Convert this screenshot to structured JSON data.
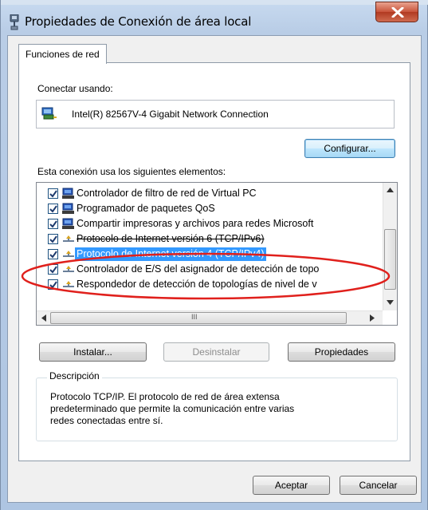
{
  "window": {
    "title": "Propiedades de Conexión de área local",
    "close_icon": "close-icon"
  },
  "tabs": [
    {
      "label": "Funciones de red",
      "active": true
    }
  ],
  "connect_using": {
    "label": "Conectar usando:",
    "adapter_name": "Intel(R) 82567V-4 Gigabit Network Connection",
    "adapter_icon": "network-adapter-icon",
    "configure_button": "Configurar..."
  },
  "components": {
    "label": "Esta conexión usa los siguientes elementos:",
    "items": [
      {
        "label": "Controlador de filtro de red de Virtual PC",
        "checked": true,
        "icon": "network-client-icon",
        "selected": false
      },
      {
        "label": "Programador de paquetes QoS",
        "checked": true,
        "icon": "network-client-icon",
        "selected": false
      },
      {
        "label": "Compartir impresoras y archivos para redes Microsoft",
        "checked": true,
        "icon": "network-client-icon",
        "selected": false
      },
      {
        "label": "Protocolo de Internet versión 6 (TCP/IPv6)",
        "checked": true,
        "icon": "protocol-icon",
        "selected": false
      },
      {
        "label": "Protocolo de Internet versión 4 (TCP/IPv4)",
        "checked": true,
        "icon": "protocol-icon",
        "selected": true
      },
      {
        "label": "Controlador de E/S del asignador de detección de topo",
        "checked": true,
        "icon": "protocol-icon",
        "selected": false
      },
      {
        "label": "Respondedor de detección de topologías de nivel de v",
        "checked": true,
        "icon": "protocol-icon",
        "selected": false
      }
    ],
    "hscroll_thumb_label": "III"
  },
  "actions": {
    "install": "Instalar...",
    "uninstall": "Desinstalar",
    "properties": "Propiedades"
  },
  "description": {
    "legend": "Descripción",
    "text": "Protocolo TCP/IP. El protocolo de red de área extensa\npredeterminado que permite la comunicación entre varias\nredes conectadas entre sí."
  },
  "footer": {
    "accept": "Aceptar",
    "cancel": "Cancelar"
  },
  "colors": {
    "selection": "#3399ff",
    "annotation": "#e0201c"
  }
}
